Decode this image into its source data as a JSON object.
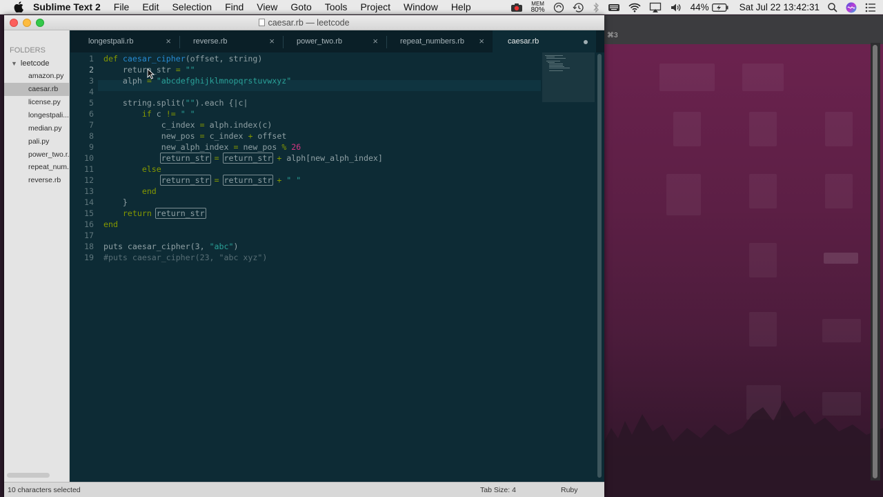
{
  "menubar": {
    "app_name": "Sublime Text 2",
    "items": [
      "File",
      "Edit",
      "Selection",
      "Find",
      "View",
      "Goto",
      "Tools",
      "Project",
      "Window",
      "Help"
    ],
    "mem_label": "MEM",
    "mem_value": "80%",
    "battery": "44%",
    "clock": "Sat Jul 22  13:42:31"
  },
  "window": {
    "title": "caesar.rb — leetcode"
  },
  "sidebar": {
    "folders_label": "FOLDERS",
    "root_folder": "leetcode",
    "files": [
      "amazon.py",
      "caesar.rb",
      "license.py",
      "longestpali...",
      "median.py",
      "pali.py",
      "power_two.r...",
      "repeat_num...",
      "reverse.rb"
    ],
    "active_index": 1
  },
  "tabs": [
    {
      "label": "longestpali.rb",
      "close": "×"
    },
    {
      "label": "reverse.rb",
      "close": "×"
    },
    {
      "label": "power_two.rb",
      "close": "×"
    },
    {
      "label": "repeat_numbers.rb",
      "close": "×"
    },
    {
      "label": "caesar.rb",
      "active": true
    }
  ],
  "editor": {
    "current_line": 2,
    "line_numbers": [
      "1",
      "2",
      "3",
      "4",
      "5",
      "6",
      "7",
      "8",
      "9",
      "10",
      "11",
      "12",
      "13",
      "14",
      "15",
      "16",
      "17",
      "18",
      "19"
    ],
    "code": {
      "l1_def": "def",
      "l1_name": "caesar_cipher",
      "l1_args": "(offset, string)",
      "l2_var": "return_str",
      "l2_op": "=",
      "l2_str": "\"\"",
      "l3_var": "alph",
      "l3_op": "=",
      "l3_str": "\"abcdefghijklmnopqrstuvwxyz\"",
      "l5_a": "string.split(",
      "l5_str": "\"\"",
      "l5_b": ").each {|c|",
      "l6_if": "if",
      "l6_c": "c",
      "l6_op": "!=",
      "l6_str": "\" \"",
      "l7_a": "c_index",
      "l7_op": "=",
      "l7_b": "alph.index(c)",
      "l8_a": "new_pos",
      "l8_op": "=",
      "l8_b": "c_index",
      "l8_op2": "+",
      "l8_c": "offset",
      "l9_a": "new_alph_index",
      "l9_op": "=",
      "l9_b": "new_pos",
      "l9_op2": "%",
      "l9_num": "26",
      "l10_a": "return_str",
      "l10_op": "=",
      "l10_b": "return_str",
      "l10_op2": "+",
      "l10_c": "alph[new_alph_index]",
      "l11_else": "else",
      "l12_a": "return_str",
      "l12_op": "=",
      "l12_b": "return_str",
      "l12_op2": "+",
      "l12_str": "\" \"",
      "l13_end": "end",
      "l14_brace": "}",
      "l15_return": "return",
      "l15_var": "return_str",
      "l16_end": "end",
      "l18_a": "puts caesar_cipher(3, ",
      "l18_str": "\"abc\"",
      "l18_b": ")",
      "l19_comment": "#puts caesar_cipher(23, \"abc xyz\")"
    }
  },
  "statusbar": {
    "selection": "10 characters selected",
    "tab_size": "Tab Size: 4",
    "syntax": "Ruby"
  },
  "desktop": {
    "space_label": "⌘3"
  },
  "colors": {
    "editor_bg": "#0d2b35",
    "keyword": "#859900",
    "function": "#268bd2",
    "string": "#2aa198",
    "number": "#d33682"
  }
}
